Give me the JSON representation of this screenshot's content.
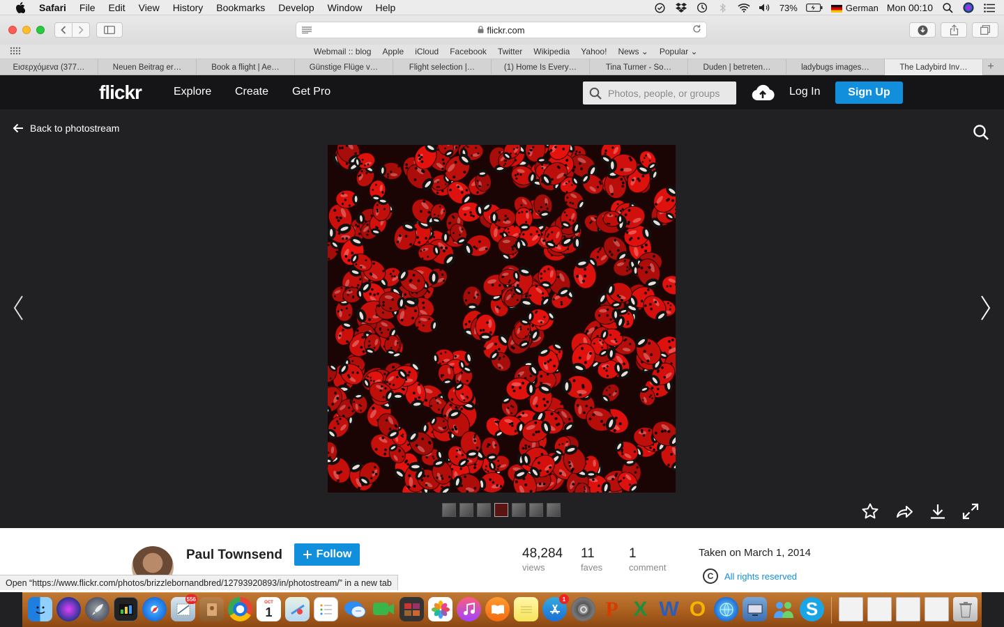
{
  "menubar": {
    "app": "Safari",
    "items": [
      "File",
      "Edit",
      "View",
      "History",
      "Bookmarks",
      "Develop",
      "Window",
      "Help"
    ],
    "battery": "73%",
    "input_language": "German",
    "clock": "Mon 00:10"
  },
  "toolbar": {
    "url": "flickr.com"
  },
  "favorites": [
    "Webmail :: blog",
    "Apple",
    "iCloud",
    "Facebook",
    "Twitter",
    "Wikipedia",
    "Yahoo!",
    "News ⌄",
    "Popular ⌄"
  ],
  "tabs": [
    "Εισερχόμενα (377…",
    "Neuen Beitrag er…",
    "Book a flight | Ae…",
    "Günstige Flüge v…",
    "Flight selection |…",
    "(1) Home Is Every…",
    "Tina Turner - So…",
    "Duden | betreten…",
    "ladybugs images…",
    "The Ladybird Inv…"
  ],
  "flickr": {
    "logo": "flickr",
    "nav": [
      "Explore",
      "Create",
      "Get Pro"
    ],
    "search_placeholder": "Photos, people, or groups",
    "login": "Log In",
    "signup": "Sign Up"
  },
  "viewer": {
    "back_label": "Back to photostream",
    "thumbnail_count": 7,
    "active_thumbnail": 4
  },
  "info": {
    "owner": "Paul Townsend",
    "follow_label": "Follow",
    "views_value": "48,284",
    "views_label": "views",
    "faves_value": "11",
    "faves_label": "faves",
    "comments_value": "1",
    "comments_label": "comment",
    "taken": "Taken on March 1, 2014",
    "rights": "All rights reserved"
  },
  "status_text": "Open “https://www.flickr.com/photos/brizzlebornandbred/12793920893/in/photostream/” in a new tab",
  "dock": {
    "mail_badge": "556",
    "calendar_month": "OCT",
    "calendar_day": "1",
    "appstore_badge": "1"
  }
}
